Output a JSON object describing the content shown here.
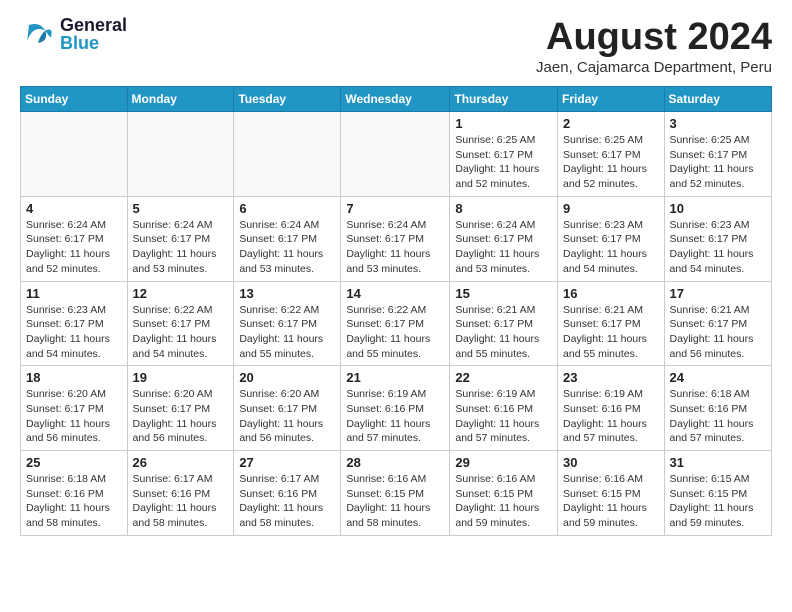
{
  "header": {
    "logo_general": "General",
    "logo_blue": "Blue",
    "month_year": "August 2024",
    "location": "Jaen, Cajamarca Department, Peru"
  },
  "weekdays": [
    "Sunday",
    "Monday",
    "Tuesday",
    "Wednesday",
    "Thursday",
    "Friday",
    "Saturday"
  ],
  "weeks": [
    [
      {
        "day": "",
        "info": ""
      },
      {
        "day": "",
        "info": ""
      },
      {
        "day": "",
        "info": ""
      },
      {
        "day": "",
        "info": ""
      },
      {
        "day": "1",
        "info": "Sunrise: 6:25 AM\nSunset: 6:17 PM\nDaylight: 11 hours\nand 52 minutes."
      },
      {
        "day": "2",
        "info": "Sunrise: 6:25 AM\nSunset: 6:17 PM\nDaylight: 11 hours\nand 52 minutes."
      },
      {
        "day": "3",
        "info": "Sunrise: 6:25 AM\nSunset: 6:17 PM\nDaylight: 11 hours\nand 52 minutes."
      }
    ],
    [
      {
        "day": "4",
        "info": "Sunrise: 6:24 AM\nSunset: 6:17 PM\nDaylight: 11 hours\nand 52 minutes."
      },
      {
        "day": "5",
        "info": "Sunrise: 6:24 AM\nSunset: 6:17 PM\nDaylight: 11 hours\nand 53 minutes."
      },
      {
        "day": "6",
        "info": "Sunrise: 6:24 AM\nSunset: 6:17 PM\nDaylight: 11 hours\nand 53 minutes."
      },
      {
        "day": "7",
        "info": "Sunrise: 6:24 AM\nSunset: 6:17 PM\nDaylight: 11 hours\nand 53 minutes."
      },
      {
        "day": "8",
        "info": "Sunrise: 6:24 AM\nSunset: 6:17 PM\nDaylight: 11 hours\nand 53 minutes."
      },
      {
        "day": "9",
        "info": "Sunrise: 6:23 AM\nSunset: 6:17 PM\nDaylight: 11 hours\nand 54 minutes."
      },
      {
        "day": "10",
        "info": "Sunrise: 6:23 AM\nSunset: 6:17 PM\nDaylight: 11 hours\nand 54 minutes."
      }
    ],
    [
      {
        "day": "11",
        "info": "Sunrise: 6:23 AM\nSunset: 6:17 PM\nDaylight: 11 hours\nand 54 minutes."
      },
      {
        "day": "12",
        "info": "Sunrise: 6:22 AM\nSunset: 6:17 PM\nDaylight: 11 hours\nand 54 minutes."
      },
      {
        "day": "13",
        "info": "Sunrise: 6:22 AM\nSunset: 6:17 PM\nDaylight: 11 hours\nand 55 minutes."
      },
      {
        "day": "14",
        "info": "Sunrise: 6:22 AM\nSunset: 6:17 PM\nDaylight: 11 hours\nand 55 minutes."
      },
      {
        "day": "15",
        "info": "Sunrise: 6:21 AM\nSunset: 6:17 PM\nDaylight: 11 hours\nand 55 minutes."
      },
      {
        "day": "16",
        "info": "Sunrise: 6:21 AM\nSunset: 6:17 PM\nDaylight: 11 hours\nand 55 minutes."
      },
      {
        "day": "17",
        "info": "Sunrise: 6:21 AM\nSunset: 6:17 PM\nDaylight: 11 hours\nand 56 minutes."
      }
    ],
    [
      {
        "day": "18",
        "info": "Sunrise: 6:20 AM\nSunset: 6:17 PM\nDaylight: 11 hours\nand 56 minutes."
      },
      {
        "day": "19",
        "info": "Sunrise: 6:20 AM\nSunset: 6:17 PM\nDaylight: 11 hours\nand 56 minutes."
      },
      {
        "day": "20",
        "info": "Sunrise: 6:20 AM\nSunset: 6:17 PM\nDaylight: 11 hours\nand 56 minutes."
      },
      {
        "day": "21",
        "info": "Sunrise: 6:19 AM\nSunset: 6:16 PM\nDaylight: 11 hours\nand 57 minutes."
      },
      {
        "day": "22",
        "info": "Sunrise: 6:19 AM\nSunset: 6:16 PM\nDaylight: 11 hours\nand 57 minutes."
      },
      {
        "day": "23",
        "info": "Sunrise: 6:19 AM\nSunset: 6:16 PM\nDaylight: 11 hours\nand 57 minutes."
      },
      {
        "day": "24",
        "info": "Sunrise: 6:18 AM\nSunset: 6:16 PM\nDaylight: 11 hours\nand 57 minutes."
      }
    ],
    [
      {
        "day": "25",
        "info": "Sunrise: 6:18 AM\nSunset: 6:16 PM\nDaylight: 11 hours\nand 58 minutes."
      },
      {
        "day": "26",
        "info": "Sunrise: 6:17 AM\nSunset: 6:16 PM\nDaylight: 11 hours\nand 58 minutes."
      },
      {
        "day": "27",
        "info": "Sunrise: 6:17 AM\nSunset: 6:16 PM\nDaylight: 11 hours\nand 58 minutes."
      },
      {
        "day": "28",
        "info": "Sunrise: 6:16 AM\nSunset: 6:15 PM\nDaylight: 11 hours\nand 58 minutes."
      },
      {
        "day": "29",
        "info": "Sunrise: 6:16 AM\nSunset: 6:15 PM\nDaylight: 11 hours\nand 59 minutes."
      },
      {
        "day": "30",
        "info": "Sunrise: 6:16 AM\nSunset: 6:15 PM\nDaylight: 11 hours\nand 59 minutes."
      },
      {
        "day": "31",
        "info": "Sunrise: 6:15 AM\nSunset: 6:15 PM\nDaylight: 11 hours\nand 59 minutes."
      }
    ]
  ]
}
